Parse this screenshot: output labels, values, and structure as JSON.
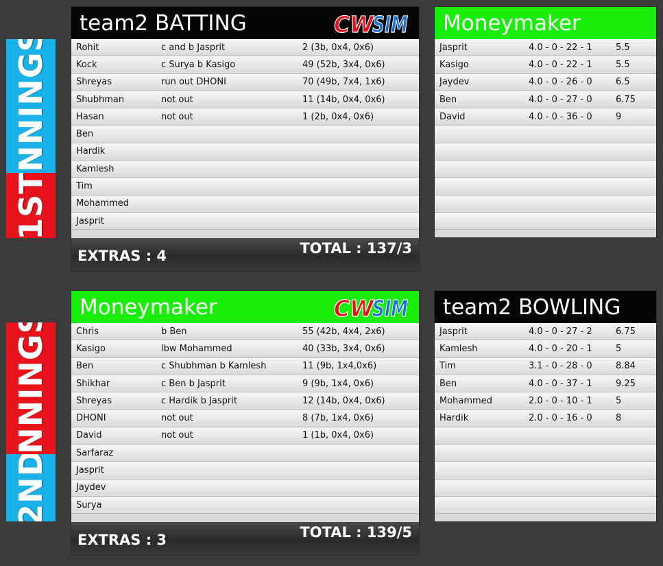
{
  "innings": [
    {
      "label_part1": "1ST",
      "label_part2": "INNINGS",
      "batting": {
        "title": "team2 BATTING",
        "logo_text": "CWSIM",
        "rows": [
          {
            "name": "Rohit",
            "how": "c and b Jasprit",
            "score": "2 (3b, 0x4, 0x6)"
          },
          {
            "name": "Kock",
            "how": "c Surya b Kasigo",
            "score": "49 (52b, 3x4, 0x6)"
          },
          {
            "name": "Shreyas",
            "how": "run out DHONI",
            "score": "70 (49b, 7x4, 1x6)"
          },
          {
            "name": "Shubhman",
            "how": "not out",
            "score": "11 (14b, 0x4, 0x6)"
          },
          {
            "name": "Hasan",
            "how": "not out",
            "score": "1 (2b, 0x4, 0x6)"
          },
          {
            "name": "Ben",
            "how": "",
            "score": ""
          },
          {
            "name": "Hardik",
            "how": "",
            "score": ""
          },
          {
            "name": "Kamlesh",
            "how": "",
            "score": ""
          },
          {
            "name": "Tim",
            "how": "",
            "score": ""
          },
          {
            "name": "Mohammed",
            "how": "",
            "score": ""
          },
          {
            "name": "Jasprit",
            "how": "",
            "score": ""
          }
        ],
        "extras": "EXTRAS : 4",
        "total": "TOTAL : 137/3"
      },
      "bowling": {
        "title": "Moneymaker",
        "rows": [
          {
            "name": "Jasprit",
            "figures": "4.0 - 0 - 22 - 1",
            "econ": "5.5"
          },
          {
            "name": "Kasigo",
            "figures": "4.0 - 0 - 22 - 1",
            "econ": "5.5"
          },
          {
            "name": "Jaydev",
            "figures": "4.0 - 0 - 26 - 0",
            "econ": "6.5"
          },
          {
            "name": "Ben",
            "figures": "4.0 - 0 - 27 - 0",
            "econ": "6.75"
          },
          {
            "name": "David",
            "figures": "4.0 - 0 - 36 - 0",
            "econ": "9"
          },
          {
            "name": "",
            "figures": "",
            "econ": ""
          },
          {
            "name": "",
            "figures": "",
            "econ": ""
          },
          {
            "name": "",
            "figures": "",
            "econ": ""
          },
          {
            "name": "",
            "figures": "",
            "econ": ""
          },
          {
            "name": "",
            "figures": "",
            "econ": ""
          },
          {
            "name": "",
            "figures": "",
            "econ": ""
          }
        ]
      }
    },
    {
      "label_part1": "2ND",
      "label_part2": "INNINGS",
      "batting": {
        "title": "Moneymaker",
        "logo_text": "CWSIM",
        "rows": [
          {
            "name": "Chris",
            "how": "b Ben",
            "score": "55 (42b, 4x4, 2x6)"
          },
          {
            "name": "Kasigo",
            "how": "lbw Mohammed",
            "score": "40 (33b, 3x4, 0x6)"
          },
          {
            "name": "Ben",
            "how": "c Shubhman b Kamlesh",
            "score": "11 (9b, 1x4,0x6)"
          },
          {
            "name": "Shikhar",
            "how": "c Ben b Jasprit",
            "score": "9 (9b, 1x4, 0x6)"
          },
          {
            "name": "Shreyas",
            "how": "c Hardik b Jasprit",
            "score": "12 (14b, 0x4, 0x6)"
          },
          {
            "name": "DHONI",
            "how": "not out",
            "score": "8 (7b, 1x4, 0x6)"
          },
          {
            "name": "David",
            "how": "not out",
            "score": "1 (1b, 0x4, 0x6)"
          },
          {
            "name": "Sarfaraz",
            "how": "",
            "score": ""
          },
          {
            "name": "Jasprit",
            "how": "",
            "score": ""
          },
          {
            "name": "Jaydev",
            "how": "",
            "score": ""
          },
          {
            "name": "Surya",
            "how": "",
            "score": ""
          }
        ],
        "extras": "EXTRAS : 3",
        "total": "TOTAL : 139/5"
      },
      "bowling": {
        "title": "team2 BOWLING",
        "rows": [
          {
            "name": "Jasprit",
            "figures": "4.0 - 0 - 27 - 2",
            "econ": "6.75"
          },
          {
            "name": "Kamlesh",
            "figures": "4.0 - 0 - 20 - 1",
            "econ": "5"
          },
          {
            "name": "Tim",
            "figures": "3.1 - 0 - 28 - 0",
            "econ": "8.84"
          },
          {
            "name": "Ben",
            "figures": "4.0 - 0 - 37 - 1",
            "econ": "9.25"
          },
          {
            "name": "Mohammed",
            "figures": "2.0 - 0 - 10 - 1",
            "econ": "5"
          },
          {
            "name": "Hardik",
            "figures": "2.0 - 0 - 16 - 0",
            "econ": "8"
          },
          {
            "name": "",
            "figures": "",
            "econ": ""
          },
          {
            "name": "",
            "figures": "",
            "econ": ""
          },
          {
            "name": "",
            "figures": "",
            "econ": ""
          },
          {
            "name": "",
            "figures": "",
            "econ": ""
          },
          {
            "name": "",
            "figures": "",
            "econ": ""
          }
        ]
      }
    }
  ],
  "colors": {
    "background": "#3b3b3b",
    "label_blue": "#1ab0e8",
    "label_red": "#e8141c",
    "header_black": "#050505",
    "header_green": "#19ee0a"
  }
}
